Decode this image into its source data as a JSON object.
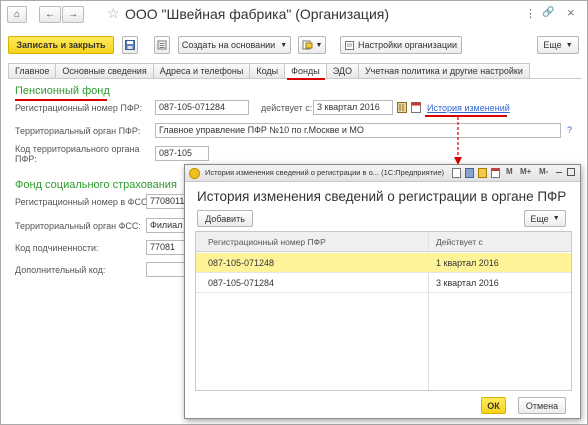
{
  "window": {
    "title": "ООО \"Швейная фабрика\" (Организация)",
    "home_icon": "⌂",
    "back_icon": "←",
    "forward_icon": "→",
    "star_icon": "☆",
    "more_icon": "⋮",
    "link_icon": "🔗",
    "close_icon": "×"
  },
  "toolbar": {
    "save_close": "Записать и закрыть",
    "create_basis": "Создать на основании",
    "org_settings": "Настройки организации",
    "more": "Еще"
  },
  "tabs": [
    "Главное",
    "Основные сведения",
    "Адреса и телефоны",
    "Коды",
    "Фонды",
    "ЭДО",
    "Учетная политика и другие настройки"
  ],
  "active_tab": "Фонды",
  "pfr": {
    "section": "Пенсионный фонд",
    "reg_label": "Регистрационный номер ПФР:",
    "reg_value": "087-105-071284",
    "since_label": "действует с:",
    "since_value": "3 квартал 2016",
    "history_link": "История изменений",
    "org_label": "Территориальный орган ПФР:",
    "org_value": "Главное управление ПФР №10 по г.Москве и МО",
    "help": "?",
    "code_label_1": "Код территориального органа",
    "code_label_2": "ПФР:",
    "code_value": "087-105"
  },
  "fss": {
    "section": "Фонд социального страхования",
    "reg_label": "Регистрационный номер в ФСС:",
    "reg_value": "7708011",
    "org_label": "Территориальный орган ФСС:",
    "org_value": "Филиал",
    "sub_label": "Код подчиненности:",
    "sub_value": "77081",
    "extra_label": "Дополнительный код:",
    "extra_value": ""
  },
  "dialog": {
    "title": "История изменения сведений о регистрации в о...  (1С:Предприятие)",
    "heading": "История изменения сведений о регистрации в органе ПФР",
    "add_button": "Добавить",
    "more_button": "Еще",
    "columns": [
      "Регистрационный номер ПФР",
      "Действует с"
    ],
    "rows": [
      {
        "reg": "087-105-071248",
        "since": "1 квартал 2016"
      },
      {
        "reg": "087-105-071284",
        "since": "3 квартал 2016"
      }
    ],
    "selected_row": 0,
    "ok": "ОК",
    "cancel": "Отмена",
    "tb_icons": [
      "M",
      "M+",
      "M-"
    ]
  },
  "colors": {
    "accent_yellow": "#f6d21b",
    "selection": "#fff39a",
    "annotation_red": "#d80000",
    "section_green": "#2e9b2e",
    "link_blue": "#3366cc"
  }
}
